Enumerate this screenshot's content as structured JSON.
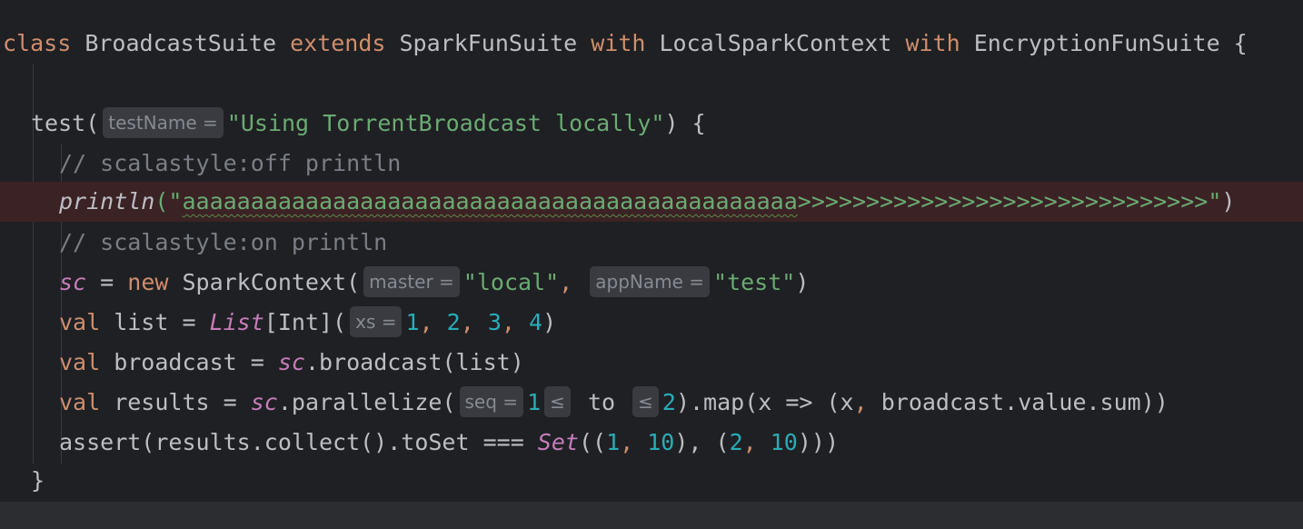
{
  "lines": {
    "l1": {
      "kw_class": "class",
      "name": " BroadcastSuite ",
      "kw_extends": "extends",
      "parent": " SparkFunSuite ",
      "kw_with1": "with",
      "mixin1": " LocalSparkContext ",
      "kw_with2": "with",
      "mixin2": " EncryptionFunSuite {"
    },
    "l3": {
      "fn": "test(",
      "hint": "testName =",
      "str": "\"Using TorrentBroadcast locally\"",
      "tail": ") {"
    },
    "l4": {
      "comment": "// scalastyle:off println"
    },
    "l5": {
      "fn": "println",
      "open": "(\"",
      "typo": "aaaaaaaaaaaaaaaaaaaaaaaaaaaaaaaaaaaaaaaaaaaaa",
      "rest": ">>>>>>>>>>>>>>>>>>>>>>>>>>>>>>\"",
      "close": ")"
    },
    "l6": {
      "comment": "// scalastyle:on println"
    },
    "l7": {
      "sc": "sc",
      "eq": " = ",
      "kw_new": "new",
      "ctor": " SparkContext(",
      "hint1": "master =",
      "str1": "\"local\"",
      "comma": ", ",
      "hint2": "appName =",
      "str2": "\"test\"",
      "tail": ")"
    },
    "l8": {
      "kw_val": "val",
      "decl": " list = ",
      "type": "List",
      "generic": "[Int](",
      "hint": "xs =",
      "n1": "1",
      "c1": ", ",
      "n2": "2",
      "c2": ", ",
      "n3": "3",
      "c3": ", ",
      "n4": "4",
      "tail": ")"
    },
    "l9": {
      "kw_val": "val",
      "decl": " broadcast = ",
      "sc": "sc",
      "tail": ".broadcast(list)"
    },
    "l10": {
      "kw_val": "val",
      "decl": " results = ",
      "sc": "sc",
      "call": ".parallelize(",
      "hint1": "seq =",
      "n1": "1",
      "hint2": "≤",
      "to": " to ",
      "hint3": "≤",
      "n2": "2",
      "tail1": ").map(x => (x",
      "comma": ",",
      "tail2": " broadcast.value.sum))"
    },
    "l11": {
      "head": "assert(results.collect().toSet === ",
      "type": "Set",
      "p1": "((",
      "n1": "1",
      "c1": ", ",
      "n2": "10",
      "p2": "), (",
      "n3": "2",
      "c2": ", ",
      "n4": "10",
      "p3": ")))"
    },
    "l12": {
      "brace": "}"
    }
  },
  "colors": {
    "background": "#1f2023",
    "keyword": "#cf8e6d",
    "string": "#6aab73",
    "number": "#2aacb8",
    "comment": "#7a7e85",
    "member": "#c77dbb",
    "error_line": "#3b2224"
  }
}
